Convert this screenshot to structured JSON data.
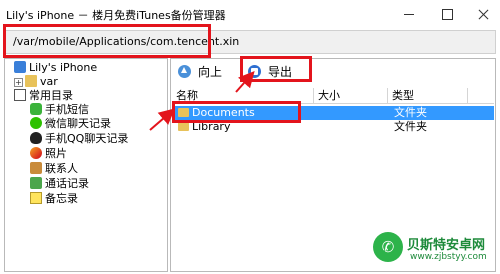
{
  "window": {
    "title": "Lily's iPhone － 楼月免费iTunes备份管理器"
  },
  "path_bar": {
    "value": "/var/mobile/Applications/com.tencent.xin"
  },
  "tree": {
    "device": "Lily's iPhone",
    "var": "var",
    "common_dirs": "常用目录",
    "items": [
      "手机短信",
      "微信聊天记录",
      "手机QQ聊天记录",
      "照片",
      "联系人",
      "通话记录",
      "备忘录"
    ]
  },
  "toolbar": {
    "up_label": "向上",
    "export_label": "导出"
  },
  "list": {
    "columns": [
      "名称",
      "大小",
      "类型"
    ],
    "rows": [
      {
        "name": "Documents",
        "size": "",
        "type": "文件夹"
      },
      {
        "name": "Library",
        "size": "",
        "type": "文件夹"
      }
    ]
  },
  "watermark": {
    "title": "贝斯特安卓网",
    "url": "www.zjbstyy.com"
  },
  "colors": {
    "highlight_box": "#e3141c",
    "selection": "#3399ff",
    "watermark": "#1d8a3a"
  }
}
